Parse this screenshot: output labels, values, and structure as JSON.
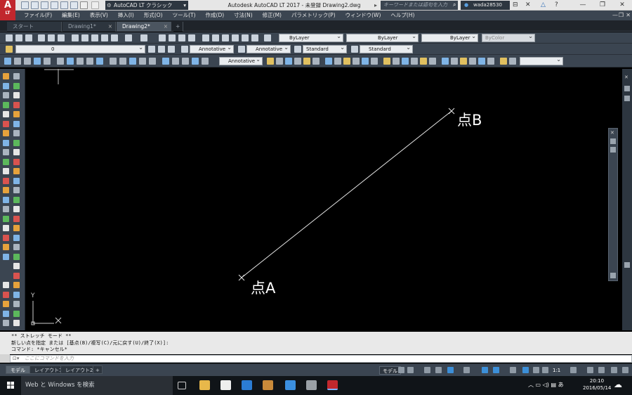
{
  "app": {
    "logo_text": "A",
    "logo_sub": "LT",
    "title": "Autodesk AutoCAD LT 2017 - 未登録    Drawing2.dwg",
    "workspace": "AutoCAD LT クラシック",
    "search_placeholder": "キーワードまたは語句を入力",
    "user": "wada28530"
  },
  "menu": [
    "ファイル(F)",
    "編集(E)",
    "表示(V)",
    "挿入(I)",
    "形式(O)",
    "ツール(T)",
    "作成(D)",
    "寸法(N)",
    "修正(M)",
    "パラメトリック(P)",
    "ウィンドウ(W)",
    "ヘルプ(H)"
  ],
  "tabs": [
    {
      "label": "スタート"
    },
    {
      "label": "Drawing1*",
      "close": "×"
    },
    {
      "label": "Drawing2*",
      "close": "×"
    },
    {
      "label": "+"
    }
  ],
  "properties": {
    "color": "ByLayer",
    "linetype": "ByLayer",
    "lineweight": "ByLayer",
    "plotstyle": "ByColor"
  },
  "layers": {
    "current_layer": "0",
    "text_style_scale": "Annotative",
    "dim_style": "Annotative",
    "table_style": "Standard",
    "multileader_style": "Standard"
  },
  "dim_toolbar": {
    "dim_style": "Annotative"
  },
  "drawing": {
    "point_a_label": "点A",
    "point_b_label": "点B",
    "ucs_y": "Y",
    "ucs_x": "X"
  },
  "command": {
    "history": [
      "** ストレッチ モード **",
      "新しい点を指定 または [基点(B)/複写(C)/元に戻す(U)/終了(X)]:",
      "コマンド: *キャンセル*"
    ],
    "placeholder": "ここにコマンドを入力"
  },
  "layout_tabs": [
    "モデル",
    "レイアウト1",
    "レイアウト2",
    "+"
  ],
  "status": {
    "model": "モデル",
    "scale": "1:1"
  },
  "taskbar": {
    "search": "Web と Windows を検索",
    "time": "20:10",
    "date": "2016/05/14",
    "ime": "あ"
  },
  "colors": {
    "accent_red": "#c1272d",
    "toolbar_bg": "#3b4551",
    "canvas_bg": "#000000"
  }
}
